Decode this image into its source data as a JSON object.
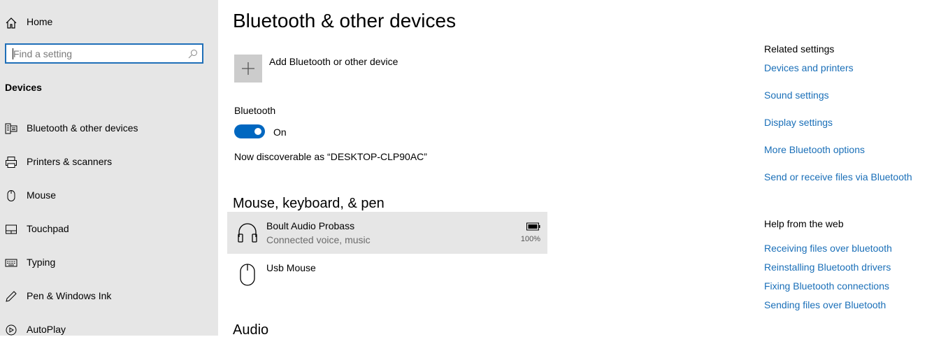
{
  "sidebar": {
    "home_label": "Home",
    "search": {
      "placeholder": "Find a setting",
      "value": ""
    },
    "section_title": "Devices",
    "items": [
      {
        "label": "Bluetooth & other devices",
        "icon": "keyboard-icon"
      },
      {
        "label": "Printers & scanners",
        "icon": "printer-icon"
      },
      {
        "label": "Mouse",
        "icon": "mouse-icon"
      },
      {
        "label": "Touchpad",
        "icon": "touchpad-icon"
      },
      {
        "label": "Typing",
        "icon": "keyboard-typing-icon"
      },
      {
        "label": "Pen & Windows Ink",
        "icon": "pen-icon"
      },
      {
        "label": "AutoPlay",
        "icon": "autoplay-icon"
      }
    ]
  },
  "main": {
    "title": "Bluetooth & other devices",
    "add_device_label": "Add Bluetooth or other device",
    "bluetooth_label": "Bluetooth",
    "bluetooth_state": "On",
    "discoverable_text": "Now discoverable as “DESKTOP-CLP90AC”",
    "mouse_section_title": "Mouse, keyboard, & pen",
    "devices": [
      {
        "name": "Boult Audio Probass",
        "status": "Connected voice, music",
        "battery": "100%",
        "icon": "headphones-icon"
      },
      {
        "name": "Usb Mouse",
        "status": "",
        "battery": "",
        "icon": "mouse-icon"
      }
    ],
    "audio_section_title": "Audio"
  },
  "related": {
    "title": "Related settings",
    "links": [
      "Devices and printers",
      "Sound settings",
      "Display settings",
      "More Bluetooth options",
      "Send or receive files via Bluetooth"
    ]
  },
  "help": {
    "title": "Help from the web",
    "links": [
      "Receiving files over bluetooth",
      "Reinstalling Bluetooth drivers",
      "Fixing Bluetooth connections",
      "Sending files over Bluetooth"
    ]
  },
  "colors": {
    "accent": "#0067c0",
    "link": "#1a6fb8",
    "sidebar_bg": "#e6e6e6"
  }
}
